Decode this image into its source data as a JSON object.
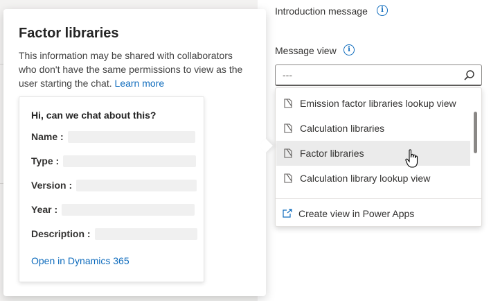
{
  "right_panel": {
    "intro_label": "Introduction message",
    "message_view_label": "Message view",
    "search_value": "---"
  },
  "dropdown": {
    "items": [
      {
        "label": "Emission factor libraries lookup view",
        "selected": false
      },
      {
        "label": "Calculation libraries",
        "selected": false
      },
      {
        "label": "Factor libraries",
        "selected": true
      },
      {
        "label": "Calculation library lookup view",
        "selected": false
      }
    ],
    "footer_label": "Create view in Power Apps"
  },
  "popover": {
    "title": "Factor libraries",
    "description": "This information may be shared with collaborators who don't have the same permissions to view as the user starting the chat.",
    "learn_more": "Learn more",
    "card": {
      "heading": "Hi, can we chat about this?",
      "fields": [
        "Name :",
        "Type :",
        "Version :",
        "Year :",
        "Description :"
      ],
      "open_link": "Open in Dynamics 365"
    }
  },
  "colors": {
    "accent": "#0f6cbd",
    "selected_bg": "#ebebeb",
    "placeholder": "#f0f0f0"
  },
  "icons": [
    "info-icon",
    "search-icon",
    "document-icon",
    "open-external-icon",
    "hand-cursor-icon"
  ]
}
